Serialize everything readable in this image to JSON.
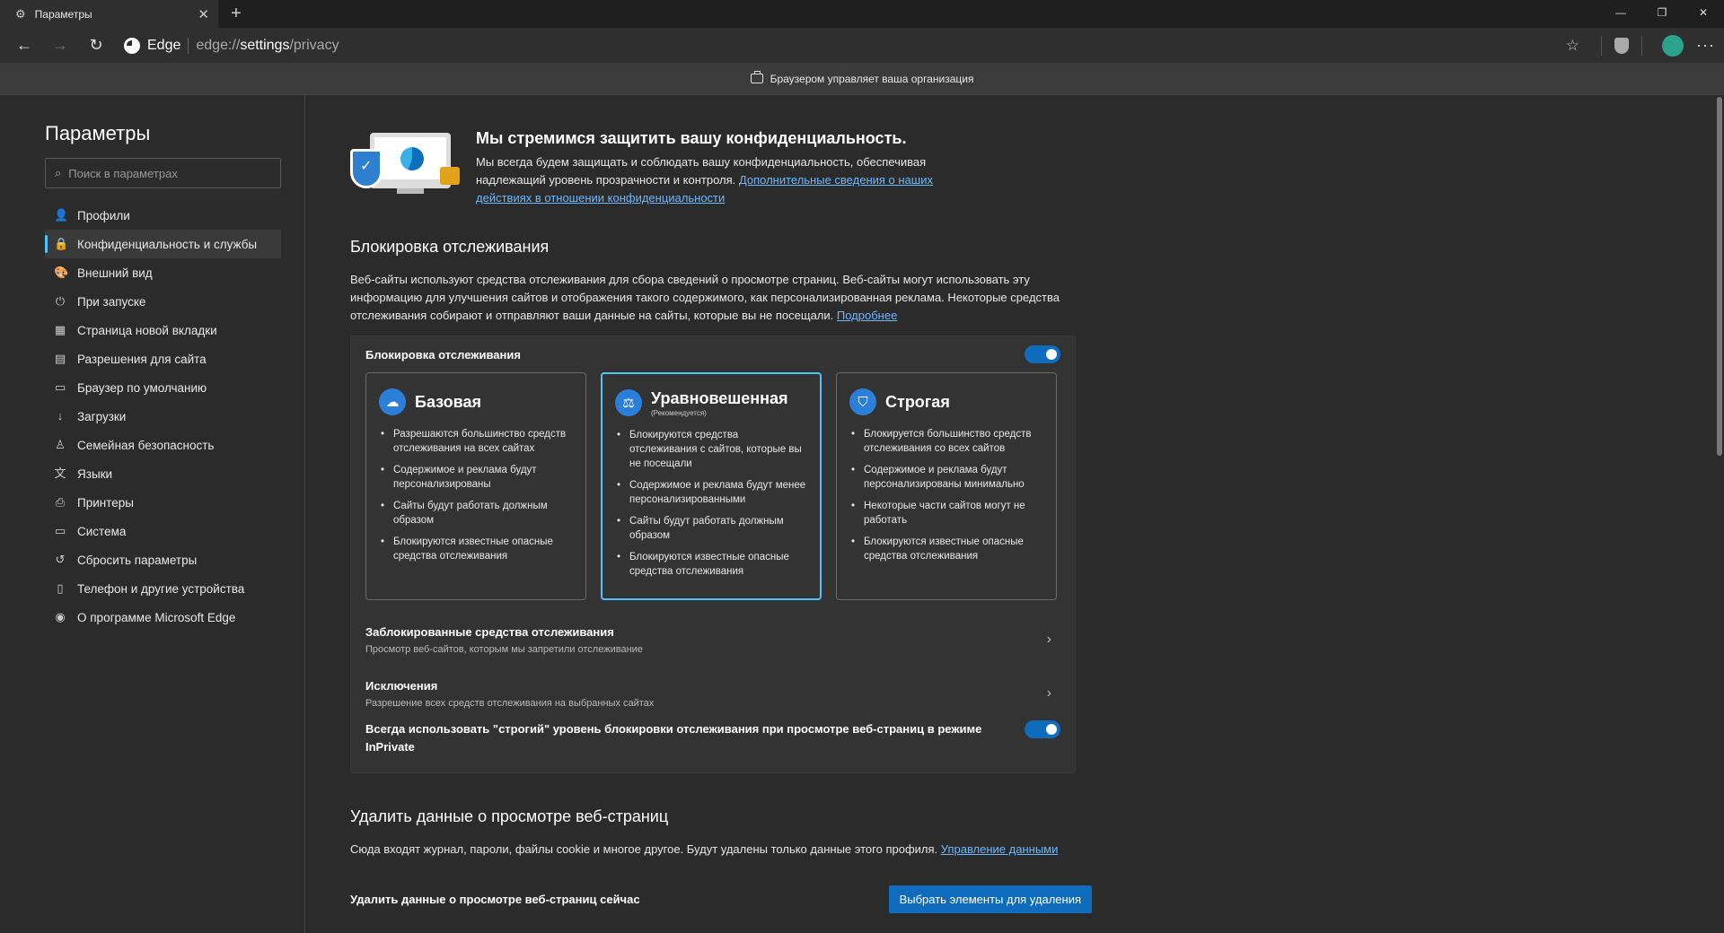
{
  "browser": {
    "tab_title": "Параметры",
    "tab_close": "✕",
    "new_tab": "+",
    "brand": "Edge",
    "url_prefix": "edge://",
    "url_host": "settings",
    "url_path": "/privacy",
    "infobar_text": "Браузером управляет ваша организация"
  },
  "sidebar": {
    "title": "Параметры",
    "search_placeholder": "Поиск в параметрах",
    "items": [
      {
        "label": "Профили",
        "icon": "👤"
      },
      {
        "label": "Конфиденциальность и службы",
        "icon": "🔒"
      },
      {
        "label": "Внешний вид",
        "icon": "🎨"
      },
      {
        "label": "При запуске",
        "icon": "⏻"
      },
      {
        "label": "Страница новой вкладки",
        "icon": "▦"
      },
      {
        "label": "Разрешения для сайта",
        "icon": "▤"
      },
      {
        "label": "Браузер по умолчанию",
        "icon": "▭"
      },
      {
        "label": "Загрузки",
        "icon": "↓"
      },
      {
        "label": "Семейная безопасность",
        "icon": "♙"
      },
      {
        "label": "Языки",
        "icon": "文"
      },
      {
        "label": "Принтеры",
        "icon": "⎙"
      },
      {
        "label": "Система",
        "icon": "▭"
      },
      {
        "label": "Сбросить параметры",
        "icon": "↺"
      },
      {
        "label": "Телефон и другие устройства",
        "icon": "▯"
      },
      {
        "label": "О программе Microsoft Edge",
        "icon": "◉"
      }
    ]
  },
  "hero": {
    "title": "Мы стремимся защитить вашу конфиденциальность.",
    "text": "Мы всегда будем защищать и соблюдать вашу конфиденциальность, обеспечивая надлежащий уровень прозрачности и контроля.",
    "link": "Дополнительные сведения о наших действиях в отношении конфиденциальности"
  },
  "tracking": {
    "title": "Блокировка отслеживания",
    "desc": "Веб-сайты используют средства отслеживания для сбора сведений о просмотре страниц. Веб-сайты могут использовать эту информацию для улучшения сайтов и отображения такого содержимого, как персонализированная реклама. Некоторые средства отслеживания собирают и отправляют ваши данные на сайты, которые вы не посещали.",
    "more_link": "Подробнее",
    "toggle_label": "Блокировка отслеживания",
    "options": [
      {
        "name": "Базовая",
        "sub": "",
        "bullets": [
          "Разрешаются большинство средств отслеживания на всех сайтах",
          "Содержимое и реклама будут персонализированы",
          "Сайты будут работать должным образом",
          "Блокируются известные опасные средства отслеживания"
        ]
      },
      {
        "name": "Уравновешенная",
        "sub": "(Рекомендуется)",
        "bullets": [
          "Блокируются средства отслеживания с сайтов, которые вы не посещали",
          "Содержимое и реклама будут менее персонализированными",
          "Сайты будут работать должным образом",
          "Блокируются известные опасные средства отслеживания"
        ]
      },
      {
        "name": "Строгая",
        "sub": "",
        "bullets": [
          "Блокируется большинство средств отслеживания со всех сайтов",
          "Содержимое и реклама будут персонализированы минимально",
          "Некоторые части сайтов могут не работать",
          "Блокируются известные опасные средства отслеживания"
        ]
      }
    ],
    "blocked_title": "Заблокированные средства отслеживания",
    "blocked_sub": "Просмотр веб-сайтов, которым мы запретили отслеживание",
    "exceptions_title": "Исключения",
    "exceptions_sub": "Разрешение всех средств отслеживания на выбранных сайтах",
    "inprivate": "Всегда использовать \"строгий\" уровень блокировки отслеживания при просмотре веб-страниц в режиме InPrivate"
  },
  "clear": {
    "title": "Удалить данные о просмотре веб-страниц",
    "desc": "Сюда входят журнал, пароли, файлы cookie и многое другое. Будут удалены только данные этого профиля.",
    "link": "Управление данными",
    "now_label": "Удалить данные о просмотре веб-страниц сейчас",
    "button": "Выбрать элементы для удаления"
  }
}
